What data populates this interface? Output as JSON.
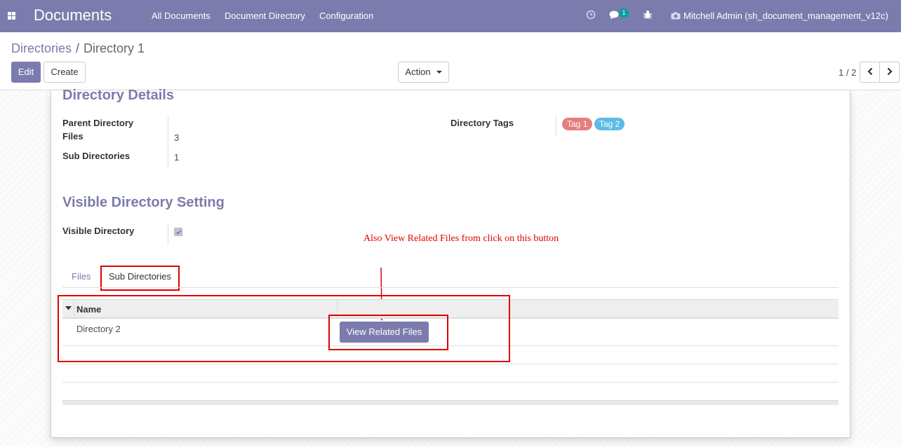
{
  "navbar": {
    "brand": "Documents",
    "menu": [
      "All Documents",
      "Document Directory",
      "Configuration"
    ],
    "chat_count": "1",
    "user": "Mitchell Admin (sh_document_management_v12c)"
  },
  "breadcrumb": {
    "parent": "Directories",
    "separator": "/",
    "current": "Directory 1"
  },
  "buttons": {
    "edit": "Edit",
    "create": "Create",
    "action": "Action"
  },
  "pager": {
    "value": "1 / 2"
  },
  "details": {
    "title": "Directory Details",
    "parent_directory_label": "Parent Directory",
    "files_label": "Files",
    "files_value": "3",
    "sub_directories_label": "Sub Directories",
    "sub_directories_value": "1",
    "tags_label": "Directory Tags",
    "tags": [
      {
        "label": "Tag 1",
        "color": "#e77d7d"
      },
      {
        "label": "Tag 2",
        "color": "#5ebbe7"
      }
    ]
  },
  "visibility": {
    "title": "Visible Directory Setting",
    "visible_label": "Visible Directory",
    "visible_checked": true
  },
  "annotation": "Also View Related Files from click on this button",
  "tabs": [
    "Files",
    "Sub Directories"
  ],
  "table": {
    "columns": [
      "Name"
    ],
    "rows": [
      {
        "name": "Directory 2",
        "button": "View Related Files"
      }
    ]
  },
  "colors": {
    "primary": "#7c7bad",
    "annotation_red": "#e00000"
  }
}
